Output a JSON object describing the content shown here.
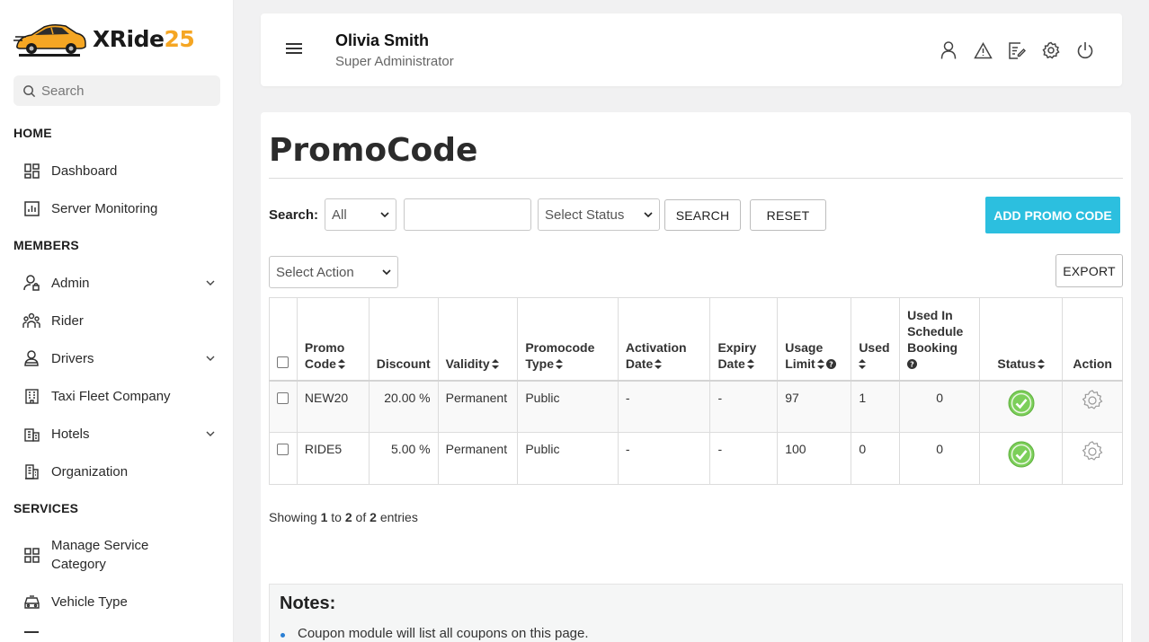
{
  "sidebar": {
    "logo": {
      "main": "XRide",
      "num": "25"
    },
    "search_placeholder": "Search",
    "sections": [
      {
        "title": "HOME",
        "items": [
          {
            "label": "Dashboard",
            "icon": "grid-icon"
          },
          {
            "label": "Server Monitoring",
            "icon": "chart-icon"
          }
        ]
      },
      {
        "title": "MEMBERS",
        "items": [
          {
            "label": "Admin",
            "icon": "user-lock-icon",
            "expandable": true
          },
          {
            "label": "Rider",
            "icon": "group-icon"
          },
          {
            "label": "Drivers",
            "icon": "driver-icon",
            "expandable": true
          },
          {
            "label": "Taxi Fleet Company",
            "icon": "building-icon"
          },
          {
            "label": "Hotels",
            "icon": "hotel-icon",
            "expandable": true
          },
          {
            "label": "Organization",
            "icon": "office-icon"
          }
        ]
      },
      {
        "title": "SERVICES",
        "items": [
          {
            "label": "Manage Service Category",
            "icon": "category-icon"
          },
          {
            "label": "Vehicle Type",
            "icon": "car-icon"
          }
        ]
      }
    ]
  },
  "header": {
    "user_name": "Olivia Smith",
    "user_role": "Super Administrator",
    "icons": [
      "user-icon",
      "warning-icon",
      "edit-document-icon",
      "settings-icon",
      "power-icon"
    ]
  },
  "page": {
    "title": "PromoCode",
    "search_label": "Search:",
    "filter_select": "All",
    "search_value": "",
    "status_select": "Select Status",
    "search_button": "SEARCH",
    "reset_button": "RESET",
    "add_button": "ADD PROMO CODE",
    "action_select": "Select Action",
    "export_button": "EXPORT"
  },
  "table": {
    "columns": [
      {
        "label": "Promo Code",
        "sortable": true
      },
      {
        "label": "Discount",
        "sortable": false
      },
      {
        "label": "Validity",
        "sortable": true
      },
      {
        "label": "Promocode Type",
        "sortable": true
      },
      {
        "label": "Activation Date",
        "sortable": true
      },
      {
        "label": "Expiry Date",
        "sortable": true
      },
      {
        "label": "Usage Limit",
        "sortable": true,
        "help": true
      },
      {
        "label": "Used",
        "sortable": true
      },
      {
        "label": "Used In Schedule Booking",
        "sortable": false,
        "help": true
      },
      {
        "label": "Status",
        "sortable": true
      },
      {
        "label": "Action",
        "sortable": false
      }
    ],
    "rows": [
      {
        "code": "NEW20",
        "discount": "20.00 %",
        "validity": "Permanent",
        "type": "Public",
        "activation": "-",
        "expiry": "-",
        "limit": "97",
        "used": "1",
        "scheduled": "0",
        "status": "active"
      },
      {
        "code": "RIDE5",
        "discount": "5.00 %",
        "validity": "Permanent",
        "type": "Public",
        "activation": "-",
        "expiry": "-",
        "limit": "100",
        "used": "0",
        "scheduled": "0",
        "status": "active"
      }
    ]
  },
  "showing": {
    "prefix": "Showing",
    "from": "1",
    "to_word": "to",
    "to": "2",
    "of_word": "of",
    "total": "2",
    "suffix": "entries"
  },
  "notes": {
    "title": "Notes:",
    "items": [
      "Coupon module will list all coupons on this page."
    ]
  },
  "colors": {
    "accent": "#2cbfdf",
    "status_ok": "#7ccf5a",
    "logo_orange": "#f5a623"
  }
}
